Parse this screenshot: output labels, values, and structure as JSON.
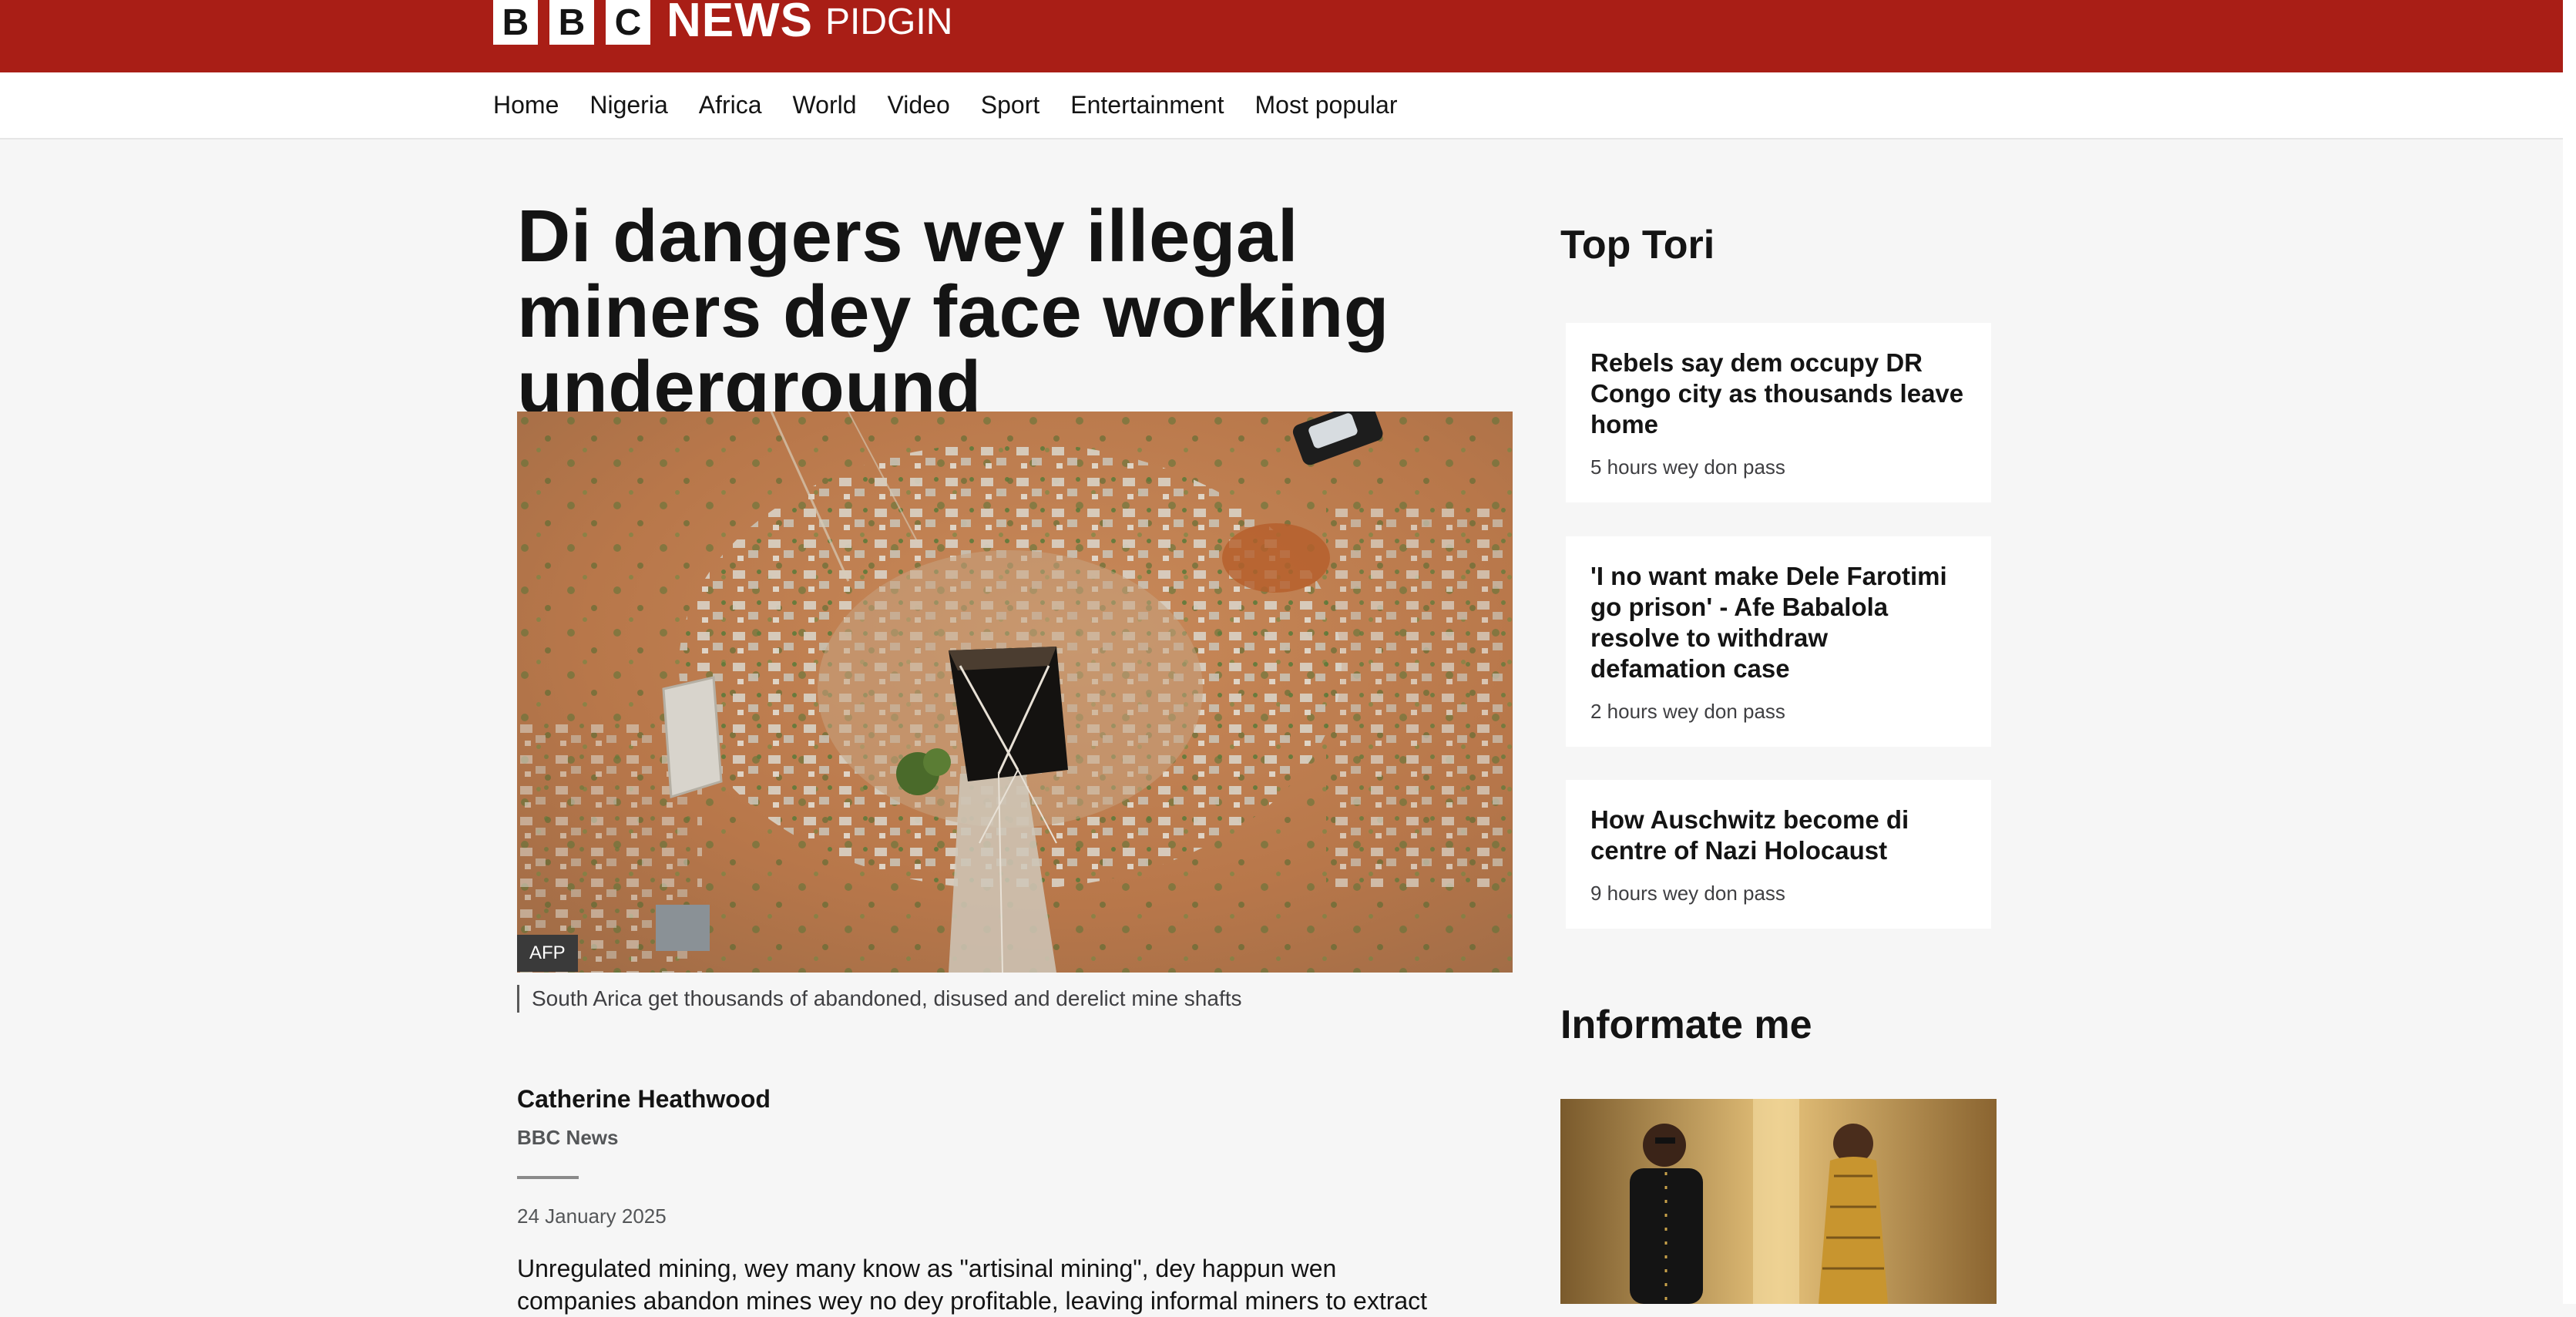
{
  "brand": {
    "blocks": [
      "B",
      "B",
      "C"
    ],
    "news": "NEWS",
    "edition": "PIDGIN",
    "color": "#a91e16"
  },
  "nav": {
    "items": [
      "Home",
      "Nigeria",
      "Africa",
      "World",
      "Video",
      "Sport",
      "Entertainment",
      "Most popular"
    ]
  },
  "article": {
    "headline": "Di dangers wey illegal miners dey face working underground",
    "image_credit": "AFP",
    "caption": "South Arica get thousands of abandoned, disused and derelict mine shafts",
    "author": "Catherine Heathwood",
    "organization": "BBC News",
    "date": "24 January 2025",
    "body": "Unregulated mining, wey many know as \"artisinal mining\", dey happun wen companies abandon mines wey no dey profitable, leaving informal miners to extract"
  },
  "sidebar": {
    "top_title": "Top Tori",
    "stories": [
      {
        "title": "Rebels say dem occupy DR Congo city as thousands leave home",
        "time": "5 hours wey don pass"
      },
      {
        "title": "'I no want make Dele Farotimi go prison' - Afe Babalola resolve to withdraw defamation case",
        "time": "2 hours wey don pass"
      },
      {
        "title": "How Auschwitz become di centre of Nazi Holocaust",
        "time": "9 hours wey don pass"
      }
    ],
    "promo_title": "Informate me"
  }
}
